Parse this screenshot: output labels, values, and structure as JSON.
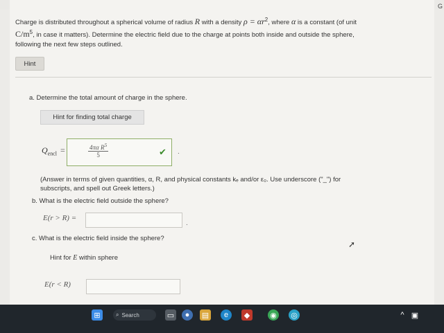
{
  "problem": {
    "p1": "Charge is distributed throughout a spherical volume of radius ",
    "R": "R",
    "p2": " with a density ",
    "density": "ρ = αr",
    "density_exp": "2",
    "p3": ", where ",
    "alpha": "α",
    "p4": " is a constant (of unit ",
    "unit": "C/m",
    "unit_exp": "5",
    "p5": ", in case it matters). Determine the electric field due to the charge at points both inside and outside the sphere, following the next few steps outlined."
  },
  "hint_label": "Hint",
  "part_a": {
    "question": "a. Determine the total amount of charge in the sphere.",
    "hint_label": "Hint for finding total charge",
    "symbol": "Q",
    "symbol_sub": "encl",
    "equals": "=",
    "answer_num": "4πα R",
    "answer_num_exp": "5",
    "answer_den": "5",
    "period": ".",
    "note": "(Answer in terms of given quantities, α, R, and physical constants kₑ and/or ε₀. Use underscore (\"_\") for subscripts, and spell out Greek letters.)"
  },
  "part_b": {
    "question": "b. What is the electric field outside the sphere?",
    "label": "E(r > R) =",
    "input_value": "",
    "period": "."
  },
  "part_c": {
    "question": "c. What is the electric field inside the sphere?",
    "hint_prefix": "Hint for ",
    "hint_math": "E",
    "hint_suffix": " within sphere",
    "label": "E(r < R)",
    "input_value": ""
  },
  "taskbar": {
    "search_label": "Search"
  },
  "colors": {
    "correct": "#3a8a2a",
    "taskbar": "#20262c"
  }
}
